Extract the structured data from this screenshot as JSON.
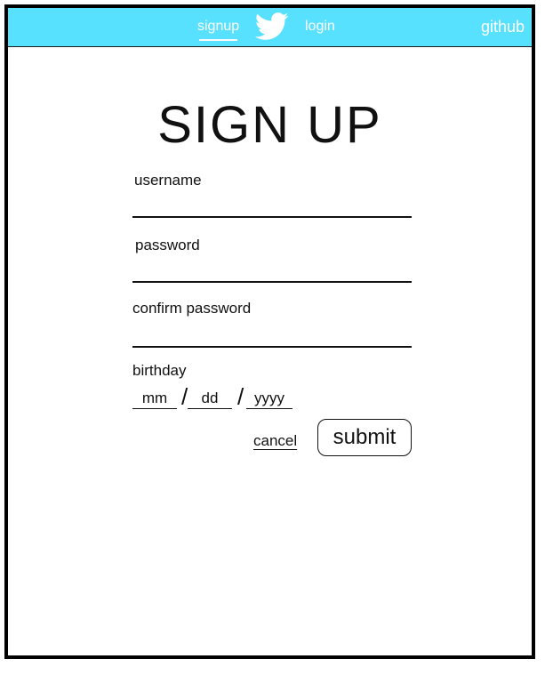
{
  "colors": {
    "nav_background": "#57E1FF",
    "nav_text": "#FFFFFF",
    "frame_border": "#000000",
    "text": "#111111"
  },
  "nav": {
    "signup_label": "signup",
    "login_label": "login",
    "github_label": "github",
    "logo_icon": "twitter-bird-icon",
    "active_tab": "signup"
  },
  "form": {
    "title": "SIGN UP",
    "username_label": "username",
    "username_value": "",
    "password_label": "password",
    "password_value": "",
    "confirm_password_label": "confirm password",
    "confirm_password_value": "",
    "birthday_label": "birthday",
    "birthday_month_placeholder": "mm",
    "birthday_day_placeholder": "dd",
    "birthday_year_placeholder": "yyyy",
    "date_separator": "/",
    "cancel_label": "cancel",
    "submit_label": "submit"
  }
}
